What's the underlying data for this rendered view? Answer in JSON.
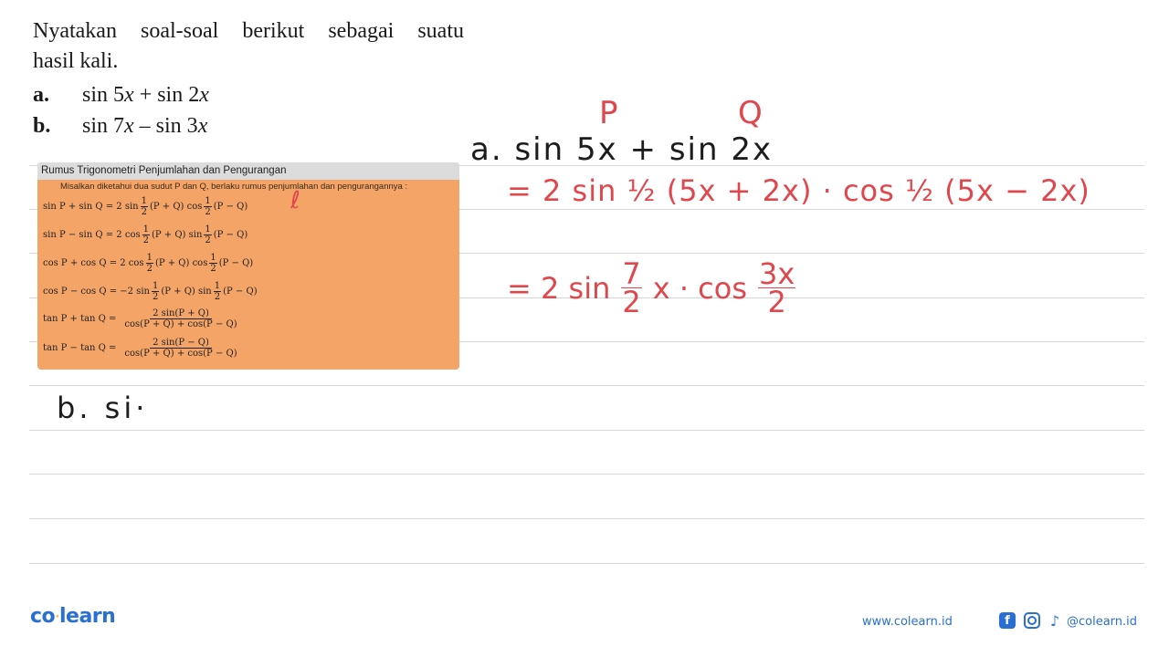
{
  "question": {
    "line1": "Nyatakan soal-soal berikut sebagai suatu",
    "line2": "hasil kali.",
    "options": [
      {
        "label": "a.",
        "expr_parts": [
          "sin 5",
          "x",
          " + sin 2",
          "x"
        ]
      },
      {
        "label": "b.",
        "expr_parts": [
          "sin 7",
          "x",
          " – sin 3",
          "x"
        ]
      }
    ]
  },
  "formula_card": {
    "title": "Rumus Trigonometri Penjumlahan dan Pengurangan",
    "intro": "Misalkan diketahui dua sudut P dan Q, berlaku rumus penjumlahan dan pengurangannya :",
    "formulas": [
      {
        "lhs": "sin P + sin Q = 2 sin",
        "f1": "(P + Q) cos",
        "f2": "(P − Q)"
      },
      {
        "lhs": "sin P − sin Q = 2 cos",
        "f1": "(P + Q) sin",
        "f2": "(P − Q)"
      },
      {
        "lhs": "cos P + cos Q = 2 cos",
        "f1": "(P + Q) cos",
        "f2": "(P − Q)"
      },
      {
        "lhs": "cos P − cos Q = −2 sin",
        "f1": "(P + Q) sin",
        "f2": "(P − Q)"
      }
    ],
    "half_num": "1",
    "half_den": "2",
    "tan_formulas": [
      {
        "lhs": "tan P + tan Q =",
        "num": "2 sin(P + Q)",
        "den": "cos(P + Q) + cos(P − Q)"
      },
      {
        "lhs": "tan P − tan Q =",
        "num": "2 sin(P − Q)",
        "den": "cos(P + Q) + cos(P − Q)"
      }
    ]
  },
  "handwriting": {
    "label_P": "P",
    "label_Q": "Q",
    "line_a": "a. sin 5x + sin 2x",
    "step1": "= 2 sin ½ (5x + 2x) · cos ½ (5x − 2x)",
    "step2_prefix": "= 2 sin",
    "step2_frac1_num": "7",
    "step2_frac1_den": "2",
    "step2_mid": "x · cos",
    "step2_frac2_num": "3x",
    "step2_frac2_den": "2",
    "line_b": "b. si·",
    "mark": "ℓ",
    "colors": {
      "ink_black": "#1c1c1c",
      "ink_red": "#e0474c"
    }
  },
  "footer": {
    "logo_left": "co",
    "logo_dot": "·",
    "logo_right": "learn",
    "url": "www.colearn.id",
    "facebook_glyph": "f",
    "tiktok_glyph": "♪",
    "handle": "@colearn.id",
    "brand_color": "#2a6fd1"
  }
}
